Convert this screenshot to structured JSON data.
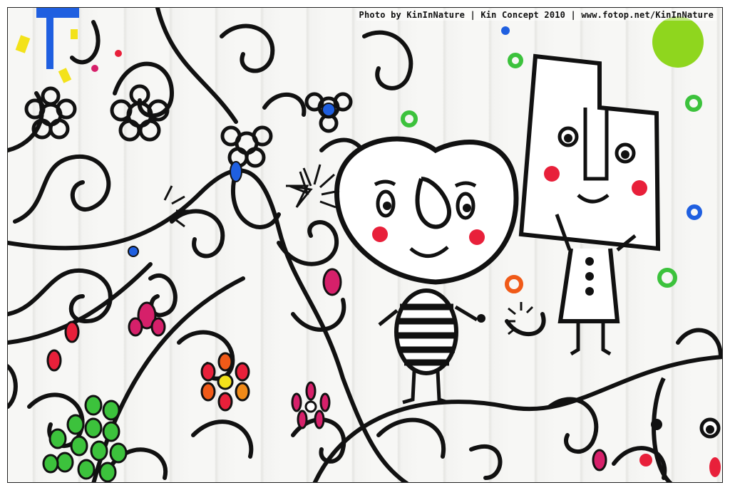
{
  "photo": {
    "caption": "Photo by KinInNature | Kin Concept 2010 | www.fotop.net/KinInNature",
    "subject": "hand-painted mural",
    "colors": {
      "ink": "#111111",
      "wall": "#f4f4f2",
      "cheek": "#e8203a",
      "green": "#3cc23c",
      "lime": "#8fd61e",
      "blue": "#1f5fe0",
      "magenta": "#d6206a",
      "orange": "#f05a18",
      "yellow": "#f3e21a"
    }
  }
}
